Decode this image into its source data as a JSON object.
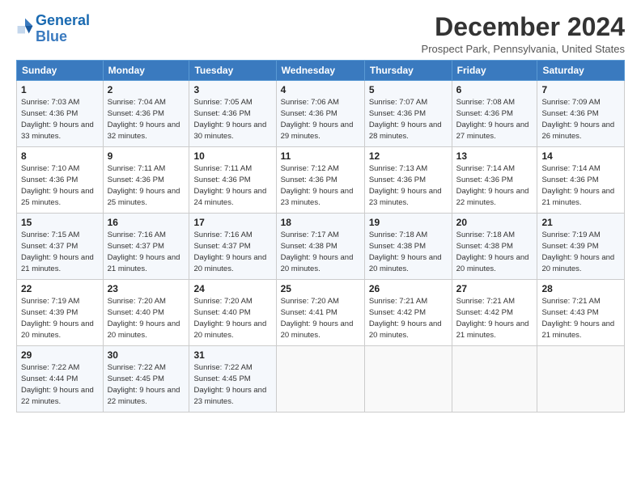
{
  "logo": {
    "line1": "General",
    "line2": "Blue"
  },
  "title": "December 2024",
  "subtitle": "Prospect Park, Pennsylvania, United States",
  "days_header": [
    "Sunday",
    "Monday",
    "Tuesday",
    "Wednesday",
    "Thursday",
    "Friday",
    "Saturday"
  ],
  "weeks": [
    [
      {
        "day": 1,
        "sunrise": "7:03 AM",
        "sunset": "4:36 PM",
        "daylight": "9 hours and 33 minutes."
      },
      {
        "day": 2,
        "sunrise": "7:04 AM",
        "sunset": "4:36 PM",
        "daylight": "9 hours and 32 minutes."
      },
      {
        "day": 3,
        "sunrise": "7:05 AM",
        "sunset": "4:36 PM",
        "daylight": "9 hours and 30 minutes."
      },
      {
        "day": 4,
        "sunrise": "7:06 AM",
        "sunset": "4:36 PM",
        "daylight": "9 hours and 29 minutes."
      },
      {
        "day": 5,
        "sunrise": "7:07 AM",
        "sunset": "4:36 PM",
        "daylight": "9 hours and 28 minutes."
      },
      {
        "day": 6,
        "sunrise": "7:08 AM",
        "sunset": "4:36 PM",
        "daylight": "9 hours and 27 minutes."
      },
      {
        "day": 7,
        "sunrise": "7:09 AM",
        "sunset": "4:36 PM",
        "daylight": "9 hours and 26 minutes."
      }
    ],
    [
      {
        "day": 8,
        "sunrise": "7:10 AM",
        "sunset": "4:36 PM",
        "daylight": "9 hours and 25 minutes."
      },
      {
        "day": 9,
        "sunrise": "7:11 AM",
        "sunset": "4:36 PM",
        "daylight": "9 hours and 25 minutes."
      },
      {
        "day": 10,
        "sunrise": "7:11 AM",
        "sunset": "4:36 PM",
        "daylight": "9 hours and 24 minutes."
      },
      {
        "day": 11,
        "sunrise": "7:12 AM",
        "sunset": "4:36 PM",
        "daylight": "9 hours and 23 minutes."
      },
      {
        "day": 12,
        "sunrise": "7:13 AM",
        "sunset": "4:36 PM",
        "daylight": "9 hours and 23 minutes."
      },
      {
        "day": 13,
        "sunrise": "7:14 AM",
        "sunset": "4:36 PM",
        "daylight": "9 hours and 22 minutes."
      },
      {
        "day": 14,
        "sunrise": "7:14 AM",
        "sunset": "4:36 PM",
        "daylight": "9 hours and 21 minutes."
      }
    ],
    [
      {
        "day": 15,
        "sunrise": "7:15 AM",
        "sunset": "4:37 PM",
        "daylight": "9 hours and 21 minutes."
      },
      {
        "day": 16,
        "sunrise": "7:16 AM",
        "sunset": "4:37 PM",
        "daylight": "9 hours and 21 minutes."
      },
      {
        "day": 17,
        "sunrise": "7:16 AM",
        "sunset": "4:37 PM",
        "daylight": "9 hours and 20 minutes."
      },
      {
        "day": 18,
        "sunrise": "7:17 AM",
        "sunset": "4:38 PM",
        "daylight": "9 hours and 20 minutes."
      },
      {
        "day": 19,
        "sunrise": "7:18 AM",
        "sunset": "4:38 PM",
        "daylight": "9 hours and 20 minutes."
      },
      {
        "day": 20,
        "sunrise": "7:18 AM",
        "sunset": "4:38 PM",
        "daylight": "9 hours and 20 minutes."
      },
      {
        "day": 21,
        "sunrise": "7:19 AM",
        "sunset": "4:39 PM",
        "daylight": "9 hours and 20 minutes."
      }
    ],
    [
      {
        "day": 22,
        "sunrise": "7:19 AM",
        "sunset": "4:39 PM",
        "daylight": "9 hours and 20 minutes."
      },
      {
        "day": 23,
        "sunrise": "7:20 AM",
        "sunset": "4:40 PM",
        "daylight": "9 hours and 20 minutes."
      },
      {
        "day": 24,
        "sunrise": "7:20 AM",
        "sunset": "4:40 PM",
        "daylight": "9 hours and 20 minutes."
      },
      {
        "day": 25,
        "sunrise": "7:20 AM",
        "sunset": "4:41 PM",
        "daylight": "9 hours and 20 minutes."
      },
      {
        "day": 26,
        "sunrise": "7:21 AM",
        "sunset": "4:42 PM",
        "daylight": "9 hours and 20 minutes."
      },
      {
        "day": 27,
        "sunrise": "7:21 AM",
        "sunset": "4:42 PM",
        "daylight": "9 hours and 21 minutes."
      },
      {
        "day": 28,
        "sunrise": "7:21 AM",
        "sunset": "4:43 PM",
        "daylight": "9 hours and 21 minutes."
      }
    ],
    [
      {
        "day": 29,
        "sunrise": "7:22 AM",
        "sunset": "4:44 PM",
        "daylight": "9 hours and 22 minutes."
      },
      {
        "day": 30,
        "sunrise": "7:22 AM",
        "sunset": "4:45 PM",
        "daylight": "9 hours and 22 minutes."
      },
      {
        "day": 31,
        "sunrise": "7:22 AM",
        "sunset": "4:45 PM",
        "daylight": "9 hours and 23 minutes."
      },
      null,
      null,
      null,
      null
    ]
  ],
  "labels": {
    "sunrise": "Sunrise:",
    "sunset": "Sunset:",
    "daylight": "Daylight:"
  }
}
